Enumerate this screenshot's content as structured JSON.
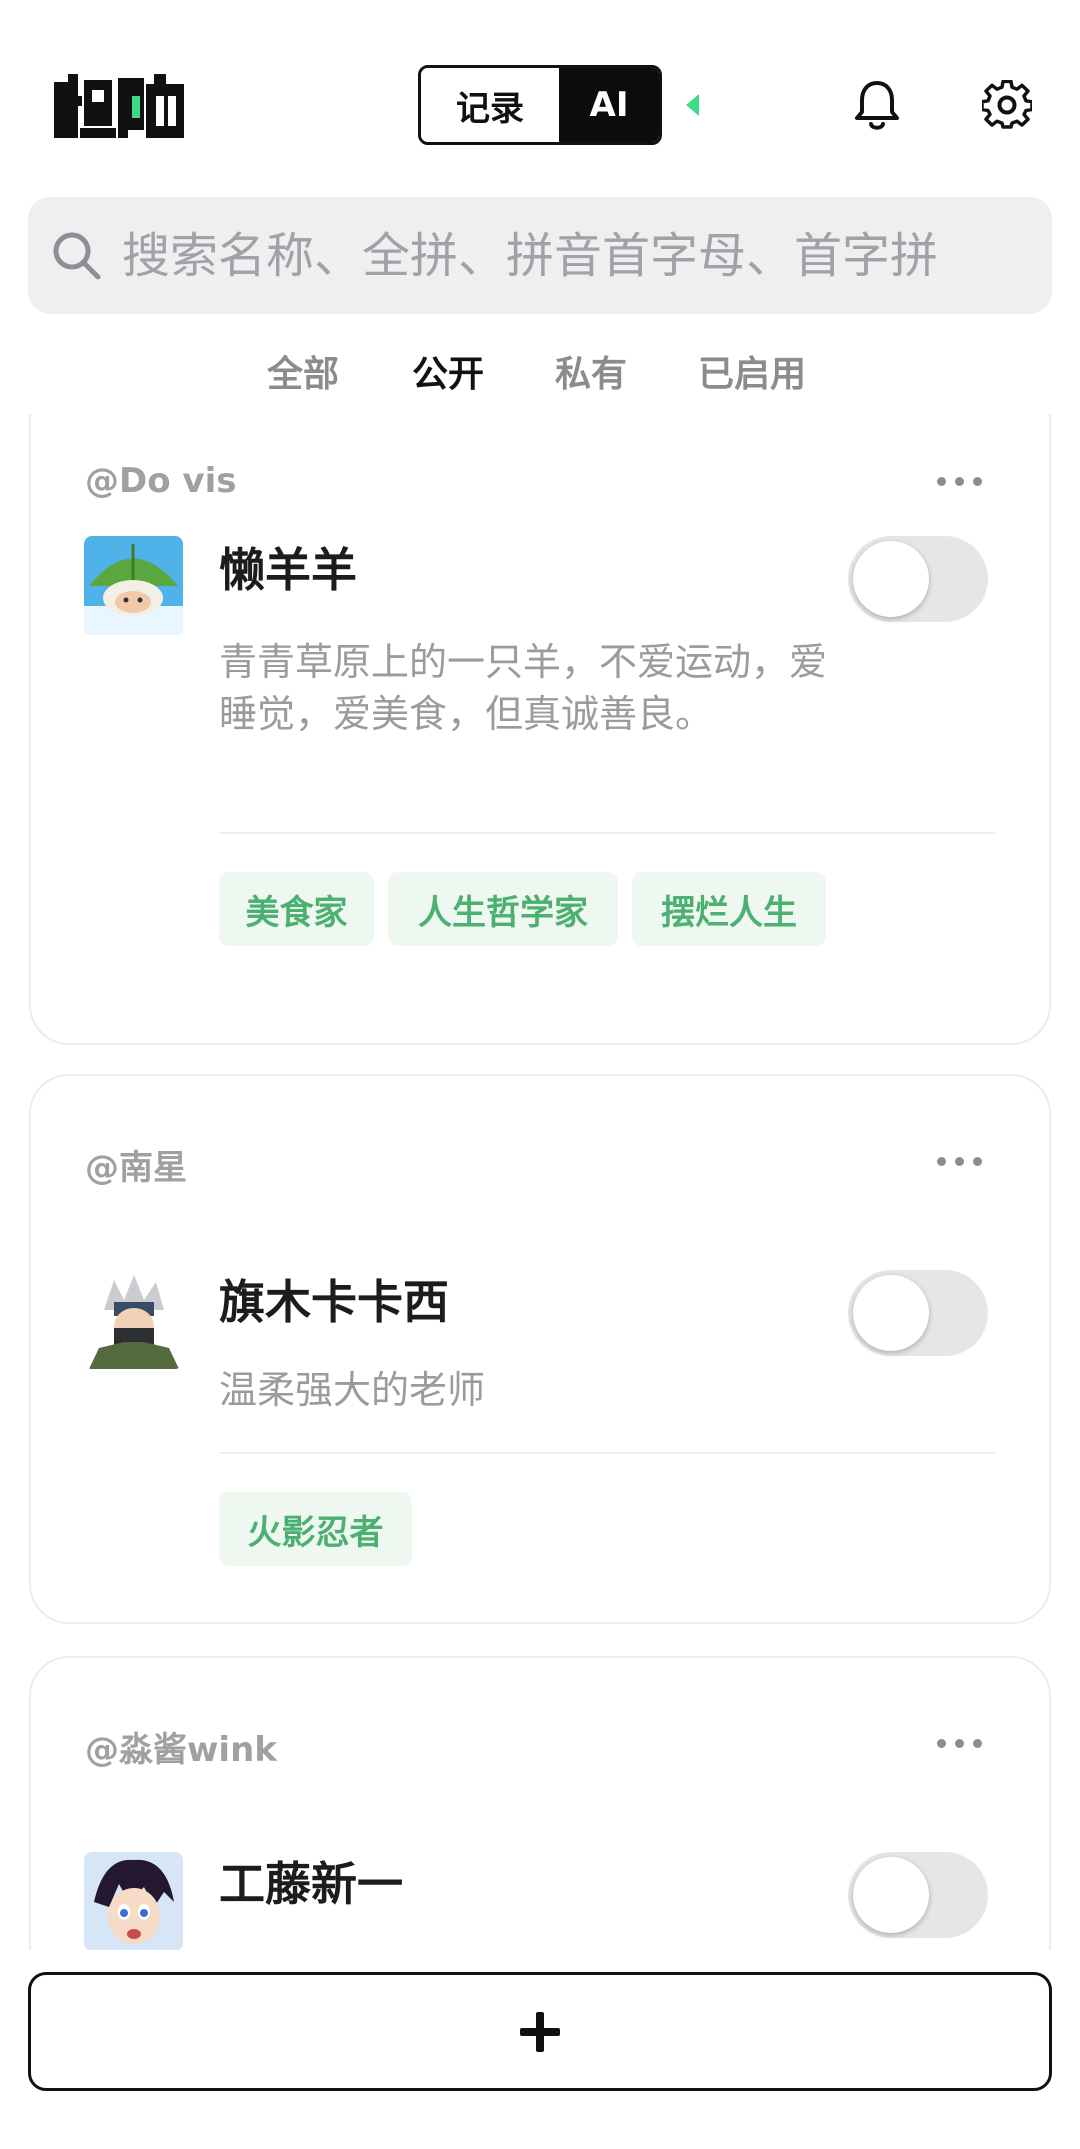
{
  "header": {
    "logo_text": "独响",
    "mode_toggle": {
      "record_label": "记录",
      "ai_label": "AI",
      "active": "AI"
    },
    "icons": [
      "bell-icon",
      "gear-icon"
    ],
    "accent_color": "#3ddc84"
  },
  "search": {
    "placeholder": "搜索名称、全拼、拼音首字母、首字拼"
  },
  "tabs": [
    {
      "label": "全部",
      "active": false
    },
    {
      "label": "公开",
      "active": true
    },
    {
      "label": "私有",
      "active": false
    },
    {
      "label": "已启用",
      "active": false
    }
  ],
  "cards": [
    {
      "author": "@Do vis",
      "name": "懒羊羊",
      "description": "青青草原上的一只羊，不爱运动，爱睡觉，爱美食，但真诚善良。",
      "enabled": false,
      "tags": [
        "美食家",
        "人生哲学家",
        "摆烂人生"
      ]
    },
    {
      "author": "@南星",
      "name": "旗木卡卡西",
      "description": "温柔强大的老师",
      "enabled": false,
      "tags": [
        "火影忍者"
      ]
    },
    {
      "author": "@淼酱wink",
      "name": "工藤新一",
      "description": "",
      "enabled": false,
      "tags": []
    }
  ],
  "add_button": {
    "icon": "plus-icon"
  },
  "colors": {
    "tag_background": "#eef8f1",
    "tag_text": "#4bb070",
    "switch_off": "#e6e6e8"
  }
}
